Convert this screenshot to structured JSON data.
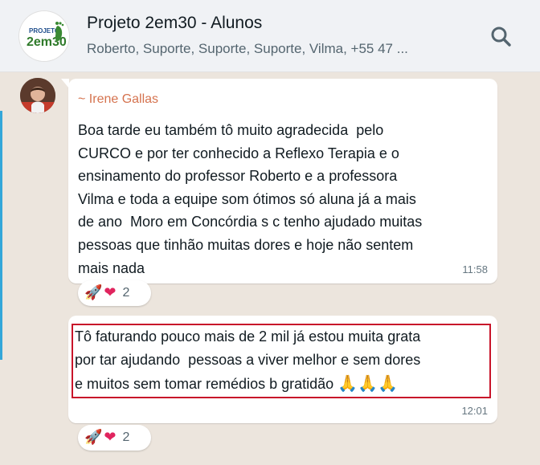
{
  "header": {
    "logo_line1": "PROJETO",
    "logo_line2": "2em30",
    "title": "Projeto 2em30 - Alunos",
    "subtitle": "Roberto, Suporte, Suporte, Suporte, Vilma, +55 47 ...",
    "search_icon": "search-icon"
  },
  "messages": [
    {
      "sender": "~ Irene Gallas",
      "sender_color": "#d5734f",
      "text": "Boa tarde eu também tô muito agradecida  pelo\nCURCO e por ter conhecido a Reflexo Terapia e o\nensinamento do professor Roberto e a professora\nVilma e toda a equipe som ótimos só aluna já a mais\nde ano  Moro em Concórdia s c tenho ajudado muitas\npessoas que tinhão muitas dores e hoje não sentem\nmais nada",
      "time": "11:58",
      "reactions": {
        "emoji": [
          "🚀",
          "❤"
        ],
        "count": "2"
      }
    },
    {
      "text": "Tô faturando pouco mais de 2 mil já estou muita grata\npor tar ajudando  pessoas a viver melhor e sem dores\ne muitos sem tomar remédios b gratidão ",
      "emoji_suffix": "🙏🙏🙏",
      "time": "12:01",
      "highlight_color": "#c8142a",
      "reactions": {
        "emoji": [
          "🚀",
          "❤"
        ],
        "count": "2"
      }
    }
  ]
}
